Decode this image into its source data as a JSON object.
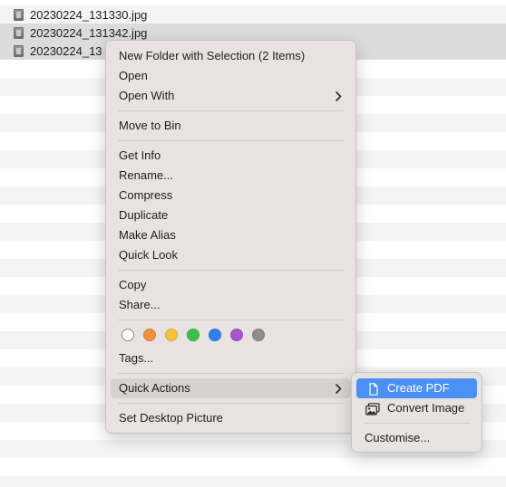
{
  "files": [
    {
      "name": "20230224_131330.jpg",
      "selected": false
    },
    {
      "name": "20230224_131342.jpg",
      "selected": true
    },
    {
      "name": "20230224_13",
      "selected": true
    }
  ],
  "context_menu": {
    "new_folder": "New Folder with Selection (2 Items)",
    "open": "Open",
    "open_with": "Open With",
    "move_to_bin": "Move to Bin",
    "get_info": "Get Info",
    "rename": "Rename...",
    "compress": "Compress",
    "duplicate": "Duplicate",
    "make_alias": "Make Alias",
    "quick_look": "Quick Look",
    "copy": "Copy",
    "share": "Share...",
    "tags": "Tags...",
    "quick_actions": "Quick Actions",
    "set_desktop_picture": "Set Desktop Picture",
    "tag_colors": [
      {
        "name": "none",
        "color": "#ffffff"
      },
      {
        "name": "orange",
        "color": "#f0913a"
      },
      {
        "name": "yellow",
        "color": "#f5c33b"
      },
      {
        "name": "green",
        "color": "#3fbe4f"
      },
      {
        "name": "blue",
        "color": "#2f7ff2"
      },
      {
        "name": "purple",
        "color": "#a757c9"
      },
      {
        "name": "grey",
        "color": "#8e8e8e"
      }
    ]
  },
  "quick_actions_submenu": {
    "create_pdf": "Create PDF",
    "convert_image": "Convert Image",
    "customise": "Customise..."
  },
  "colors": {
    "highlight": "#4a90f5",
    "menu_background": "#e8e3e1"
  }
}
